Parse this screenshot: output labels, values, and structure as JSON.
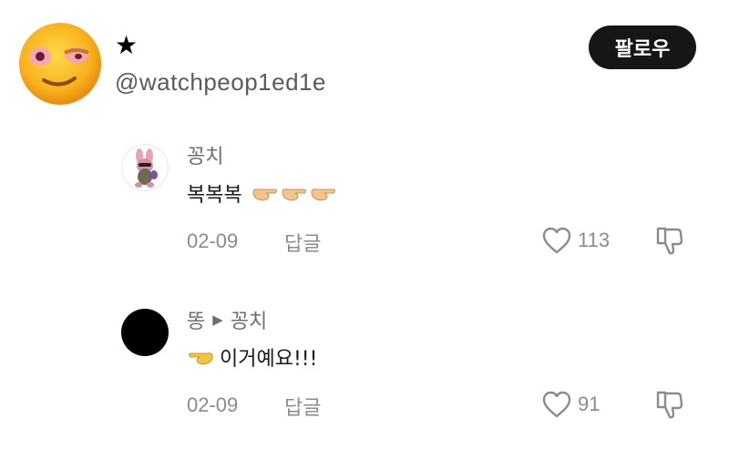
{
  "profile": {
    "name": "★",
    "handle": "@watchpeop1ed1e",
    "follow_label": "팔로우"
  },
  "comments": [
    {
      "author": "꽁치",
      "text": "복복복",
      "emoji": "👈👈👈",
      "date": "02-09",
      "reply_label": "답글",
      "likes": "113"
    },
    {
      "author": "똥",
      "reply_to": "꽁치",
      "emoji": "👈",
      "text": "이거예요!!!",
      "date": "02-09",
      "reply_label": "답글",
      "likes": "91"
    }
  ],
  "colors": {
    "follow_bg": "#161616",
    "muted_text": "#8a8a92",
    "name_text": "#6e6e78"
  }
}
